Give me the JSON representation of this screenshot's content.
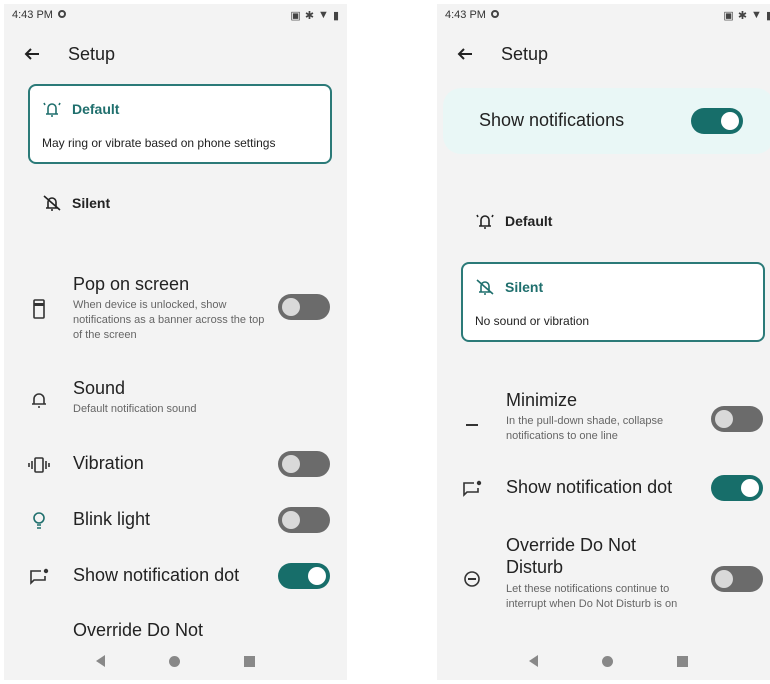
{
  "colors": {
    "accent": "#1f6f6d",
    "toggle_on": "#176e6a",
    "toggle_off": "#6b6b6b",
    "card_border": "#2b7a78",
    "highlight_bg": "#e9f7f6"
  },
  "left": {
    "status": {
      "time": "4:43 PM"
    },
    "appbar": {
      "title": "Setup",
      "back_icon": "arrow-left-icon"
    },
    "default_card": {
      "title": "Default",
      "description": "May ring or vibrate based on phone settings",
      "icon": "bell-ring-icon"
    },
    "silent_option": {
      "title": "Silent",
      "icon": "bell-off-icon"
    },
    "prefs": {
      "pop": {
        "title": "Pop on screen",
        "summary": "When device is unlocked, show notifications as a banner across the top of the screen",
        "toggle": "off"
      },
      "sound": {
        "title": "Sound",
        "summary": "Default notification sound"
      },
      "vibration": {
        "title": "Vibration",
        "toggle": "off"
      },
      "blink": {
        "title": "Blink light",
        "toggle": "off"
      },
      "dot": {
        "title": "Show notification dot",
        "toggle": "on"
      },
      "dnd": {
        "title": "Override Do Not"
      }
    }
  },
  "right": {
    "status": {
      "time": "4:43 PM"
    },
    "appbar": {
      "title": "Setup",
      "back_icon": "arrow-left-icon"
    },
    "show_notifications": {
      "title": "Show notifications",
      "toggle": "on"
    },
    "default_option": {
      "title": "Default",
      "icon": "bell-ring-icon"
    },
    "silent_card": {
      "title": "Silent",
      "description": "No sound or vibration",
      "icon": "bell-off-icon"
    },
    "prefs": {
      "minimize": {
        "title": "Minimize",
        "summary": "In the pull-down shade, collapse notifications to one line",
        "toggle": "off"
      },
      "dot": {
        "title": "Show notification dot",
        "toggle": "on"
      },
      "dnd": {
        "title": "Override Do Not Disturb",
        "summary": "Let these notifications continue to interrupt when Do Not Disturb is on",
        "toggle": "off"
      }
    }
  }
}
